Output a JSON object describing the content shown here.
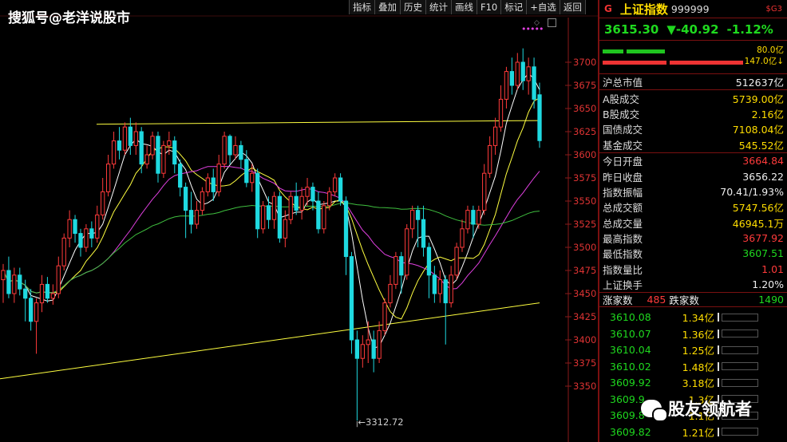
{
  "watermark_top": "搜狐号@老洋说股市",
  "watermark_bottom": "股友领航者",
  "toolbar": [
    "指标",
    "叠加",
    "历史",
    "统计",
    "画线",
    "F10",
    "标记",
    "+自选",
    "返回"
  ],
  "colors": {
    "up": "#ff3b3b",
    "down": "#1fd9e0",
    "ma5": "#ffffff",
    "ma10": "#ffff40",
    "ma20": "#e040e0",
    "ma60": "#3fbf3f",
    "trend": "#ffff40",
    "axis": "#8a1a1a",
    "label": "#d33"
  },
  "panel": {
    "logo": "G",
    "index_name": "上证指数",
    "index_code": "999999",
    "tag": "$G3",
    "price": "3615.30",
    "change": "▼-40.92",
    "change_pct": "-1.12%",
    "bar_green_label": "80.0亿",
    "bar_red_label": "147.0亿↓",
    "market_cap_label": "沪总市值",
    "market_cap": "512637亿",
    "stats_block1": [
      {
        "label": "A股成交",
        "value": "5739.00亿",
        "color": "yellow"
      },
      {
        "label": "B股成交",
        "value": "2.16亿",
        "color": "yellow"
      },
      {
        "label": "国债成交",
        "value": "7108.04亿",
        "color": "yellow"
      },
      {
        "label": "基金成交",
        "value": "545.52亿",
        "color": "yellow"
      }
    ],
    "stats_block2": [
      {
        "label": "今日开盘",
        "value": "3664.84",
        "color": "red"
      },
      {
        "label": "昨日收盘",
        "value": "3656.22",
        "color": "white"
      },
      {
        "label": "指数振幅",
        "value": "70.41/1.93%",
        "color": "white"
      },
      {
        "label": "总成交额",
        "value": "5747.56亿",
        "color": "yellow"
      },
      {
        "label": "总成交量",
        "value": "46945.1万",
        "color": "yellow"
      },
      {
        "label": "最高指数",
        "value": "3677.92",
        "color": "red"
      },
      {
        "label": "最低指数",
        "value": "3607.51",
        "color": "green"
      },
      {
        "label": "指数量比",
        "value": "1.01",
        "color": "red"
      },
      {
        "label": "上证换手",
        "value": "1.20%",
        "color": "white"
      }
    ],
    "up_label": "涨家数",
    "up_count": "485",
    "down_label": "跌家数",
    "down_count": "1490",
    "ticks": [
      {
        "price": "3610.08",
        "vol": "1.34亿"
      },
      {
        "price": "3610.07",
        "vol": "1.36亿"
      },
      {
        "price": "3610.04",
        "vol": "1.25亿"
      },
      {
        "price": "3610.02",
        "vol": "1.48亿"
      },
      {
        "price": "3609.92",
        "vol": "3.18亿"
      },
      {
        "price": "3609.9",
        "vol": "1.3亿"
      },
      {
        "price": "3609.8",
        "vol": "1.1亿"
      },
      {
        "price": "3609.82",
        "vol": "1.21亿"
      }
    ]
  },
  "chart_data": {
    "type": "candlestick",
    "title": "",
    "ylim": [
      3325,
      3730
    ],
    "yticks": [
      3350,
      3375,
      3400,
      3425,
      3450,
      3475,
      3500,
      3525,
      3550,
      3575,
      3600,
      3625,
      3650,
      3675,
      3700
    ],
    "low_annotation": "3312.72",
    "low_value": 3312.72,
    "candles": [
      [
        3465,
        3475,
        3440,
        3482
      ],
      [
        3475,
        3450,
        3445,
        3490
      ],
      [
        3450,
        3470,
        3440,
        3478
      ],
      [
        3470,
        3455,
        3448,
        3478
      ],
      [
        3455,
        3445,
        3420,
        3465
      ],
      [
        3445,
        3420,
        3410,
        3455
      ],
      [
        3420,
        3440,
        3385,
        3445
      ],
      [
        3440,
        3460,
        3430,
        3470
      ],
      [
        3460,
        3445,
        3440,
        3468
      ],
      [
        3445,
        3450,
        3438,
        3460
      ],
      [
        3450,
        3480,
        3445,
        3490
      ],
      [
        3480,
        3510,
        3475,
        3515
      ],
      [
        3510,
        3530,
        3500,
        3540
      ],
      [
        3530,
        3515,
        3505,
        3535
      ],
      [
        3515,
        3500,
        3490,
        3520
      ],
      [
        3500,
        3520,
        3495,
        3525
      ],
      [
        3520,
        3510,
        3500,
        3528
      ],
      [
        3510,
        3535,
        3505,
        3545
      ],
      [
        3535,
        3560,
        3530,
        3575
      ],
      [
        3560,
        3590,
        3555,
        3600
      ],
      [
        3590,
        3615,
        3585,
        3625
      ],
      [
        3615,
        3605,
        3595,
        3630
      ],
      [
        3605,
        3630,
        3600,
        3635
      ],
      [
        3630,
        3610,
        3600,
        3640
      ],
      [
        3610,
        3625,
        3600,
        3635
      ],
      [
        3625,
        3590,
        3580,
        3630
      ],
      [
        3590,
        3600,
        3585,
        3610
      ],
      [
        3600,
        3620,
        3595,
        3625
      ],
      [
        3620,
        3580,
        3570,
        3625
      ],
      [
        3580,
        3610,
        3575,
        3615
      ],
      [
        3610,
        3615,
        3600,
        3625
      ],
      [
        3615,
        3590,
        3580,
        3620
      ],
      [
        3590,
        3565,
        3555,
        3595
      ],
      [
        3565,
        3540,
        3510,
        3570
      ],
      [
        3540,
        3525,
        3515,
        3560
      ],
      [
        3525,
        3540,
        3520,
        3550
      ],
      [
        3540,
        3560,
        3535,
        3565
      ],
      [
        3560,
        3575,
        3555,
        3580
      ],
      [
        3575,
        3560,
        3550,
        3585
      ],
      [
        3560,
        3590,
        3555,
        3600
      ],
      [
        3590,
        3620,
        3585,
        3625
      ],
      [
        3620,
        3600,
        3590,
        3622
      ],
      [
        3600,
        3610,
        3595,
        3620
      ],
      [
        3610,
        3595,
        3585,
        3615
      ],
      [
        3595,
        3570,
        3565,
        3605
      ],
      [
        3570,
        3580,
        3560,
        3590
      ],
      [
        3580,
        3520,
        3510,
        3585
      ],
      [
        3520,
        3545,
        3515,
        3550
      ],
      [
        3545,
        3530,
        3520,
        3555
      ],
      [
        3530,
        3555,
        3520,
        3560
      ],
      [
        3555,
        3510,
        3505,
        3560
      ],
      [
        3510,
        3530,
        3500,
        3540
      ],
      [
        3530,
        3555,
        3525,
        3560
      ],
      [
        3555,
        3540,
        3535,
        3570
      ],
      [
        3540,
        3555,
        3530,
        3565
      ],
      [
        3555,
        3565,
        3545,
        3575
      ],
      [
        3565,
        3550,
        3540,
        3570
      ],
      [
        3550,
        3520,
        3515,
        3560
      ],
      [
        3520,
        3545,
        3515,
        3550
      ],
      [
        3545,
        3560,
        3540,
        3565
      ],
      [
        3560,
        3575,
        3555,
        3580
      ],
      [
        3575,
        3550,
        3545,
        3580
      ],
      [
        3550,
        3490,
        3470,
        3555
      ],
      [
        3490,
        3400,
        3385,
        3495
      ],
      [
        3400,
        3380,
        3312.72,
        3410
      ],
      [
        3380,
        3395,
        3370,
        3405
      ],
      [
        3395,
        3400,
        3375,
        3420
      ],
      [
        3400,
        3380,
        3365,
        3410
      ],
      [
        3380,
        3410,
        3375,
        3420
      ],
      [
        3410,
        3440,
        3405,
        3445
      ],
      [
        3440,
        3460,
        3435,
        3470
      ],
      [
        3460,
        3490,
        3455,
        3495
      ],
      [
        3490,
        3470,
        3450,
        3495
      ],
      [
        3470,
        3520,
        3465,
        3525
      ],
      [
        3520,
        3540,
        3510,
        3545
      ],
      [
        3540,
        3530,
        3500,
        3545
      ],
      [
        3530,
        3500,
        3490,
        3545
      ],
      [
        3500,
        3470,
        3445,
        3505
      ],
      [
        3470,
        3450,
        3440,
        3480
      ],
      [
        3450,
        3465,
        3440,
        3475
      ],
      [
        3465,
        3440,
        3395,
        3470
      ],
      [
        3440,
        3470,
        3435,
        3480
      ],
      [
        3470,
        3500,
        3465,
        3505
      ],
      [
        3500,
        3520,
        3495,
        3530
      ],
      [
        3520,
        3540,
        3515,
        3545
      ],
      [
        3540,
        3525,
        3510,
        3545
      ],
      [
        3525,
        3540,
        3520,
        3545
      ],
      [
        3540,
        3580,
        3535,
        3590
      ],
      [
        3580,
        3610,
        3575,
        3620
      ],
      [
        3610,
        3630,
        3600,
        3640
      ],
      [
        3630,
        3660,
        3625,
        3675
      ],
      [
        3660,
        3690,
        3650,
        3695
      ],
      [
        3690,
        3675,
        3665,
        3705
      ],
      [
        3675,
        3700,
        3670,
        3710
      ],
      [
        3700,
        3680,
        3670,
        3715
      ],
      [
        3680,
        3695,
        3665,
        3705
      ],
      [
        3695,
        3660,
        3650,
        3705
      ],
      [
        3664.84,
        3615.3,
        3607.51,
        3677.92
      ]
    ]
  }
}
